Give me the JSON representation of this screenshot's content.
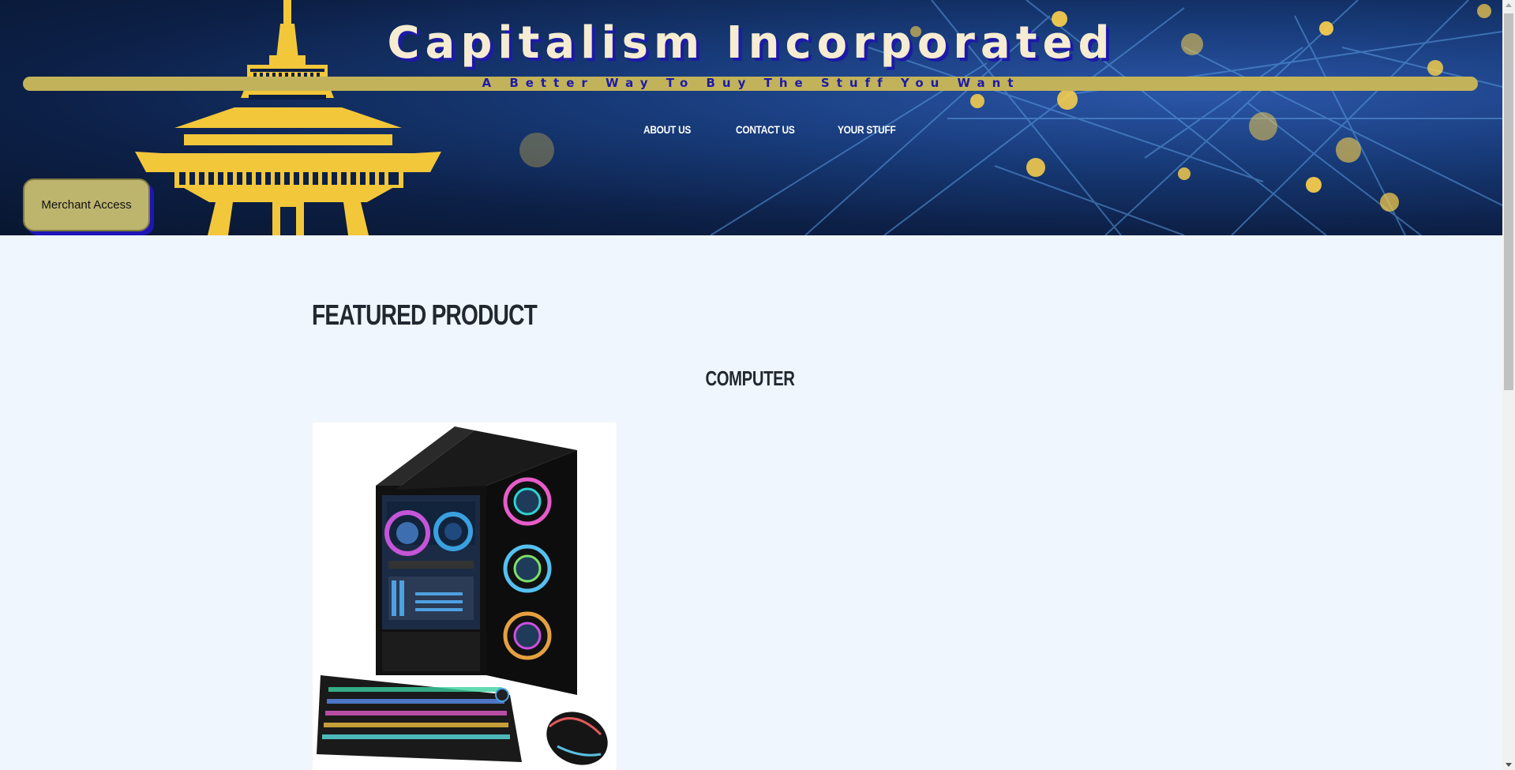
{
  "header": {
    "title": "Capitalism Incorporated",
    "tagline": "A Better Way To Buy The Stuff You Want",
    "logo_icon": "space-needle-icon",
    "background": "network-lights-image"
  },
  "nav": {
    "items": [
      {
        "label": "About Us"
      },
      {
        "label": "Contact Us"
      },
      {
        "label": "Your Stuff"
      }
    ]
  },
  "merchant_button": {
    "label": "Merchant Access"
  },
  "featured": {
    "section_title": "FEATURED PRODUCT",
    "product_name": "COMPUTER",
    "image": "gaming-pc-with-keyboard-and-mouse"
  },
  "colors": {
    "accent_gold": "#c2b35b",
    "brand_blue": "#1d1aa8",
    "tower_yellow": "#f3c73a",
    "page_background": "#eff6fd"
  }
}
